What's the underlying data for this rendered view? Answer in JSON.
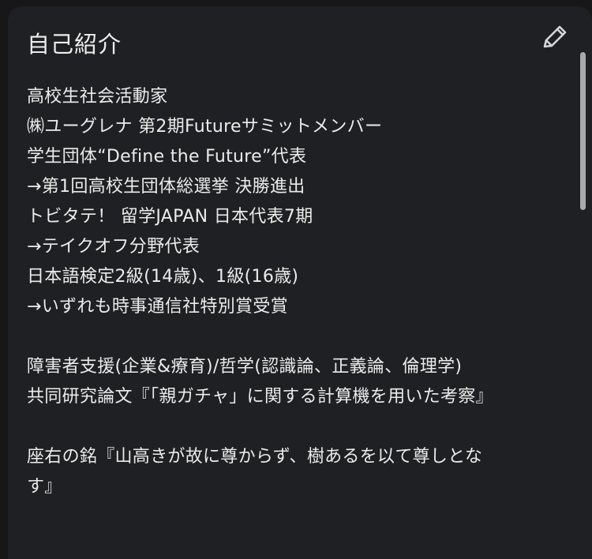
{
  "profile": {
    "title": "自己紹介",
    "lines": [
      "高校生社会活動家",
      "㈱ユーグレナ 第2期Futureサミットメンバー",
      "学生団体“Define the Future”代表",
      "→第1回高校生団体総選挙 決勝進出",
      "トビタテ！ 留学JAPAN 日本代表7期",
      "→テイクオフ分野代表",
      "日本語検定2級(14歳)、1級(16歳)",
      "→いずれも時事通信社特別賞受賞",
      "",
      "障害者支援(企業&療育)/哲学(認識論、正義論、倫理学)",
      "共同研究論文『「親ガチャ」に関する計算機を用いた考察』",
      "",
      "座右の銘『山高きが故に尊からず、樹あるを以て尊しとな",
      "す』"
    ]
  },
  "icons": {
    "edit": "pencil-icon"
  },
  "colors": {
    "background": "#17171a",
    "panel": "#1f2023",
    "text": "#ececec",
    "scrollbar": "#a9a9ad"
  }
}
